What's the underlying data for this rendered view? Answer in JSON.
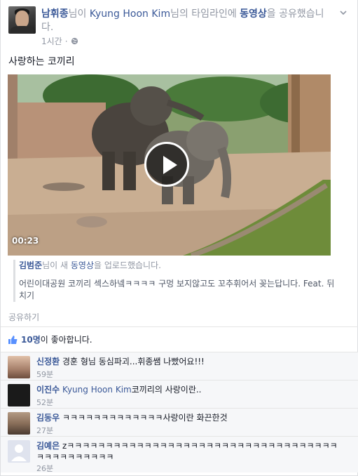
{
  "post": {
    "author": "남휘종",
    "text_part1": "님이 ",
    "shared_from": "Kyung Hoon Kim",
    "text_part2": "님의 타임라인에 ",
    "object": "동영상",
    "text_part3": "을 공유했습니다.",
    "time": "1시간",
    "status": "사랑하는 코끼리",
    "video_duration": "00:23"
  },
  "attachment": {
    "uploader": "김범준",
    "uploader_suffix": "님이 새 ",
    "object": "동영상",
    "object_suffix": "을 업로드했습니다.",
    "description": "어린이대공원 코끼리 섹스하넼ㅋㅋㅋㅋ 구멍 보지않고도 꼬추휘어서 꽂는답니다. Feat. 뒤치기"
  },
  "actions": {
    "share_label": "공유하기"
  },
  "likes": {
    "count": "10명",
    "suffix": "이 좋아합니다."
  },
  "comments": [
    {
      "name": "신정환",
      "text": "경훈 형님 동심파괴...휘종쌤 나빴어요!!!",
      "time": "59분"
    },
    {
      "name": "이진수",
      "tag": "Kyung Hoon Kim",
      "text": "코끼리의 사랑이란..",
      "time": "52분"
    },
    {
      "name": "김동우",
      "text": "ㅋㅋㅋㅋㅋㅋㅋㅋㅋㅋㅋㅋㅋ사랑이란 화끈한것",
      "time": "27분"
    },
    {
      "name": "김예은",
      "text": "zㅋㅋㅋㅋㅋㅋㅋㅋㅋㅋㅋㅋㅋㅋㅋㅋㅋㅋㅋㅋㅋㅋㅋㅋㅋㅋㅋㅋㅋㅋㅋㅋㅋㅋㅋㅋㅋㅋㅋㅋㅋㅋㅋㅋㅋ",
      "time": "26분"
    }
  ],
  "icons": {
    "menu": "chevron-down-icon",
    "privacy": "globe-icon",
    "play": "play-icon",
    "like": "thumbs-up-icon"
  },
  "colors": {
    "link": "#3b5998",
    "meta": "#9197a3",
    "text": "#141823",
    "comment_bg": "#f6f7f9"
  }
}
